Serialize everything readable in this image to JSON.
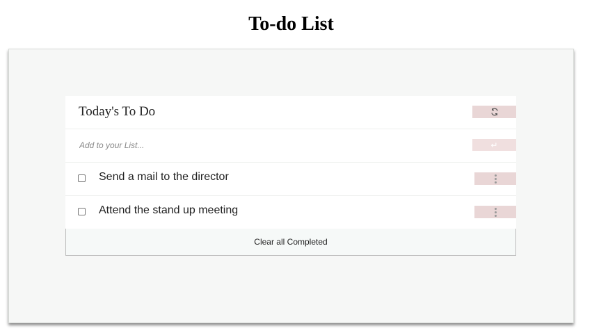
{
  "page": {
    "title": "To-do List"
  },
  "todo": {
    "header_title": "Today's To Do",
    "refresh_icon": "refresh-icon",
    "input_placeholder": "Add to your List...",
    "input_value": "",
    "enter_icon": "enter-icon",
    "tasks": [
      {
        "label": "Send a mail to the director",
        "checked": false
      },
      {
        "label": "Attend the stand up meeting",
        "checked": false
      }
    ],
    "menu_icon": "vertical-dots-icon",
    "clear_label": "Clear all Completed"
  },
  "colors": {
    "panel_background": "#f6f7f6",
    "button_accent": "#e9d6d6"
  }
}
